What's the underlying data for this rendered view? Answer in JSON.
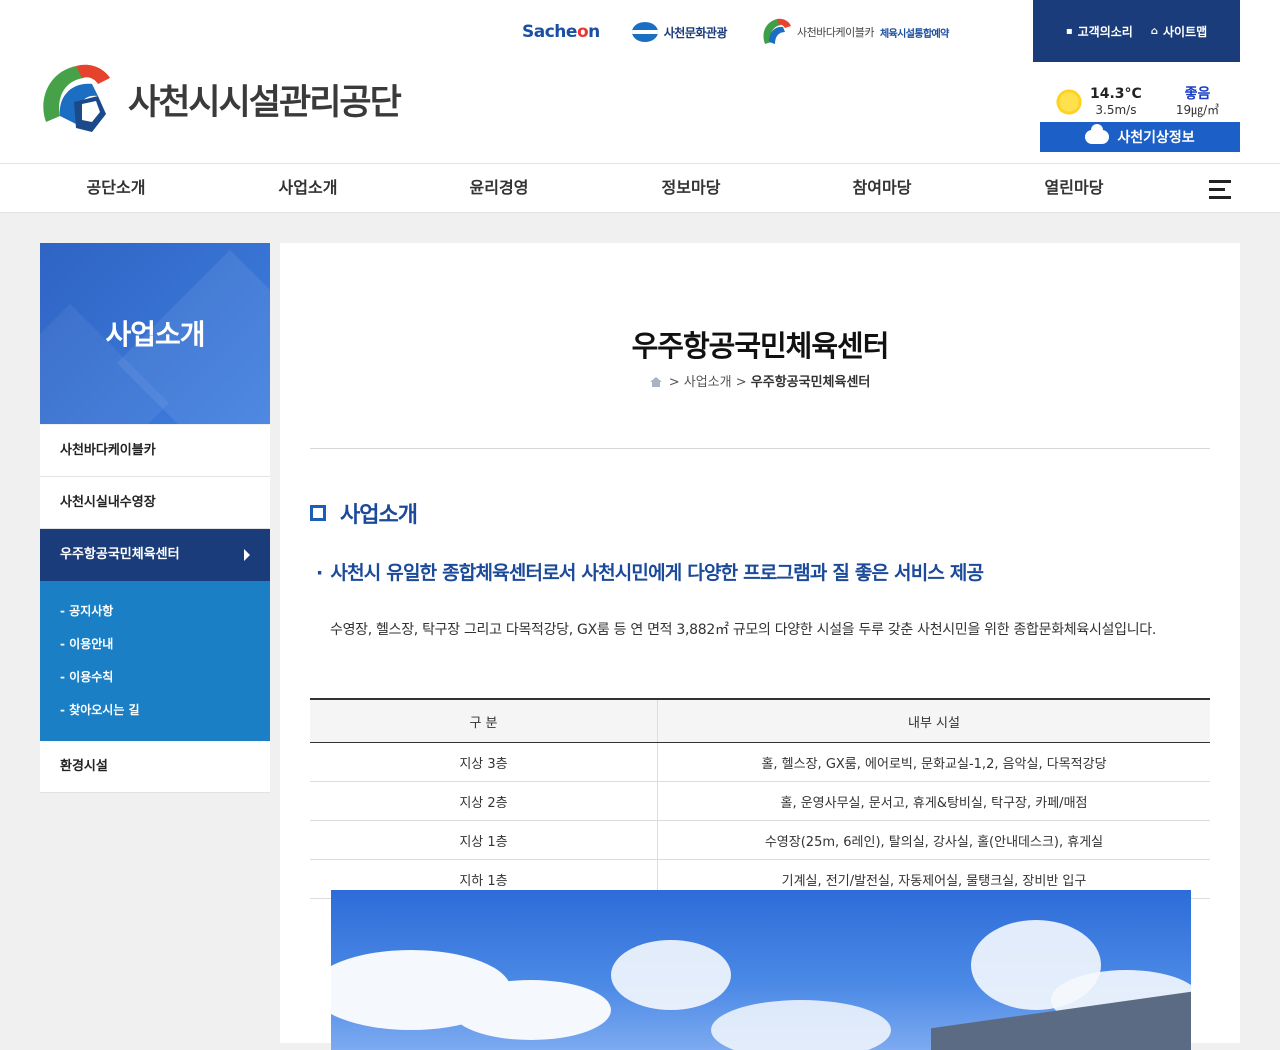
{
  "header": {
    "partners": {
      "sachon_logo_text_a": "Sache",
      "sachon_logo_text_b": "n",
      "culture_label": "사천문화관광",
      "cablecar_label": "사천바다케이블카",
      "sports_label": "체육시설통합예약"
    },
    "util": {
      "voice_label": "고객의소리",
      "sitemap_label": "사이트맵"
    },
    "logo_text": "사천시시설관리공단",
    "weather": {
      "temperature": "14.3°C",
      "wind": "3.5m/s",
      "air_status": "좋음",
      "air_value": "19㎍/㎥",
      "button_label": "사천기상정보"
    }
  },
  "gnb": [
    "공단소개",
    "사업소개",
    "윤리경영",
    "정보마당",
    "참여마당",
    "열린마당"
  ],
  "sidebar": {
    "title": "사업소개",
    "items": [
      {
        "label": "사천바다케이블카"
      },
      {
        "label": "사천시실내수영장"
      },
      {
        "label": "우주항공국민체육센터"
      },
      {
        "label": "환경시설"
      }
    ],
    "sub_items": [
      "공지사항",
      "이용안내",
      "이용수칙",
      "찾아오시는 길"
    ]
  },
  "main": {
    "page_title": "우주항공국민체육센터",
    "breadcrumb": {
      "sep1": ">",
      "crumb1": "사업소개",
      "sep2": ">",
      "crumb2": "우주항공국민체육센터"
    },
    "section_title": "사업소개",
    "headline": "사천시 유일한 종합체육센터로서 사천시민에게 다양한 프로그램과 질 좋은 서비스 제공",
    "description": "수영장, 헬스장, 탁구장 그리고 다목적강당, GX룸 등 연 면적 3,882㎡ 규모의 다양한 시설을 두루 갖춘 사천시민을 위한 종합문화체육시설입니다.",
    "table": {
      "headers": [
        "구 분",
        "내부 시설"
      ],
      "rows": [
        [
          "지상 3층",
          "홀, 헬스장, GX룸, 에어로빅, 문화교실-1,2, 음악실, 다목적강당"
        ],
        [
          "지상 2층",
          "홀, 운영사무실, 문서고, 휴게&탕비실, 탁구장, 카페/매점"
        ],
        [
          "지상 1층",
          "수영장(25m, 6레인), 탈의실, 강사실, 홀(안내데스크), 휴게실"
        ],
        [
          "지하 1층",
          "기계실, 전기/발전실, 자동제어실, 물탱크실, 장비반 입구"
        ]
      ]
    }
  },
  "colors": {
    "navy": "#1b3c7a",
    "blue": "#1c5fc7",
    "sub_menu_blue": "#1a7fc4",
    "heading_blue": "#1b4a9a"
  }
}
